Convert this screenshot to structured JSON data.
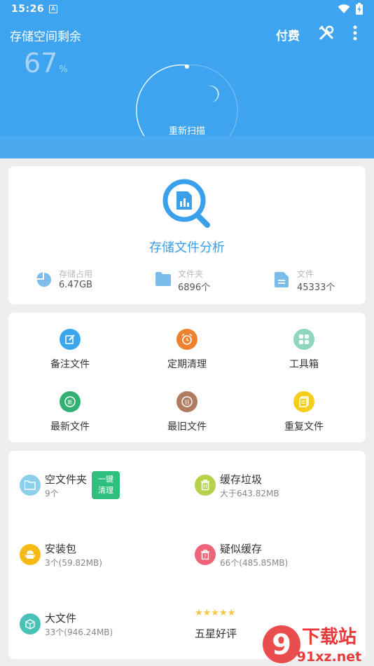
{
  "status_bar": {
    "time": "15:26",
    "a_badge": "A"
  },
  "header": {
    "title": "存储空间剩余",
    "pay_label": "付费",
    "percent_value": "67",
    "percent_unit": "%",
    "gauge_remaining_percent": 67,
    "rescan_label": "重新扫描"
  },
  "analysis": {
    "title": "存储文件分析",
    "stats": [
      {
        "icon": "pie-chart-icon",
        "label": "存储占用",
        "value": "6.47GB"
      },
      {
        "icon": "folder-icon",
        "label": "文件夹",
        "value": "6896个"
      },
      {
        "icon": "document-icon",
        "label": "文件",
        "value": "45333个"
      }
    ]
  },
  "tools_grid": [
    {
      "icon": "edit-icon",
      "label": "备注文件",
      "color": "#3aa6ee"
    },
    {
      "icon": "alarm-clock-icon",
      "label": "定期清理",
      "color": "#f0812e"
    },
    {
      "icon": "toolbox-icon",
      "label": "工具箱",
      "color": "#8fd6bb"
    },
    {
      "icon": "new-badge-icon",
      "label": "最新文件",
      "color": "#33b173"
    },
    {
      "icon": "old-badge-icon",
      "label": "最旧文件",
      "color": "#b07c60"
    },
    {
      "icon": "duplicate-icon",
      "label": "重复文件",
      "color": "#f5ce1a"
    }
  ],
  "clean_items": [
    {
      "icon": "empty-folder-icon",
      "title": "空文件夹",
      "subtitle": "9个",
      "color": "#8cd0ec"
    },
    {
      "icon": "trash-icon",
      "title": "缓存垃圾",
      "subtitle": "大于643.82MB",
      "color": "#b6d24a"
    },
    {
      "icon": "android-icon",
      "title": "安装包",
      "subtitle": "3个(59.82MB)",
      "color": "#f7b916"
    },
    {
      "icon": "suspect-cache-icon",
      "title": "疑似缓存",
      "subtitle": "66个(485.85MB)",
      "color": "#ef6478"
    },
    {
      "icon": "box-icon",
      "title": "大文件",
      "subtitle": "33个(946.24MB)",
      "color": "#48c2b9"
    }
  ],
  "one_key_clean": {
    "line1": "一键",
    "line2": "清理"
  },
  "rating": {
    "stars": "★★★★★",
    "label": "五星好评"
  },
  "watermark": {
    "text1": "下载站",
    "text2": "91xz.net",
    "logo": "9"
  }
}
